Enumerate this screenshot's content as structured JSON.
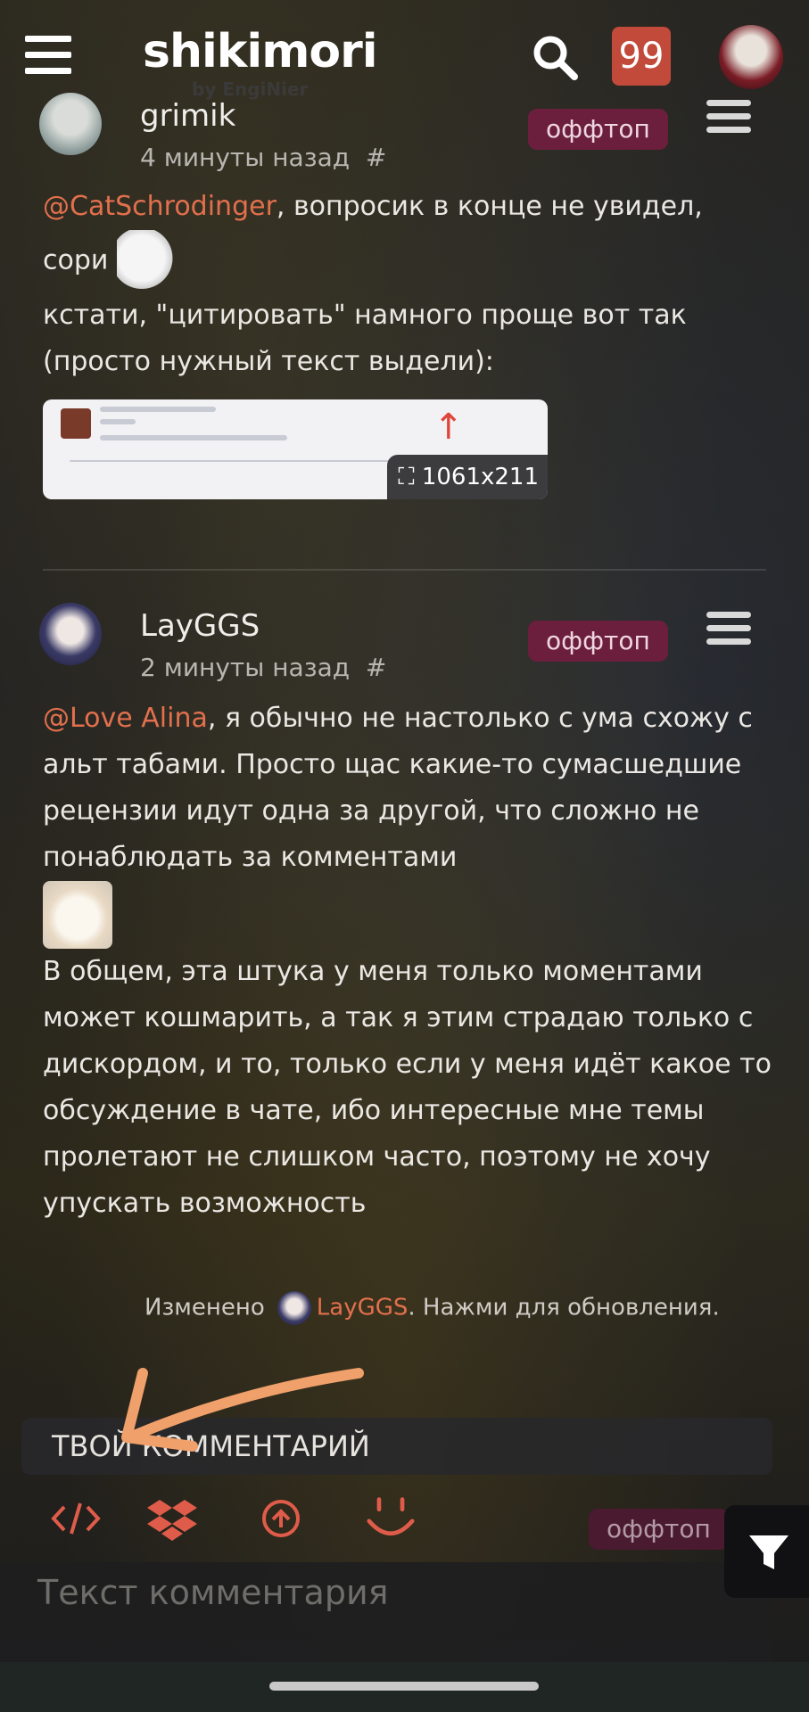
{
  "header": {
    "logo": "shikimori",
    "logo_sub": "by EngiNier",
    "notification_count": "99"
  },
  "comments": [
    {
      "author": "grimik",
      "time": "4 минуты назад",
      "hash": "#",
      "tag": "оффтоп",
      "mention": "@CatSchrodinger",
      "text_line1": ", вопросик в конце не увидел,",
      "text_line2": "сори",
      "text_line3": "кстати, \"цитировать\" намного проще вот так (просто нужный текст выдели):",
      "image_dimensions": "1061x211"
    },
    {
      "author": "LayGGS",
      "time": "2 минуты назад",
      "hash": "#",
      "tag": "оффтоп",
      "mention": "@Love Alina",
      "text_part1": ", я обычно не настолько с ума схожу с альт табами. Просто щас какие-то сумасшедшие рецензии идут одна за другой, что сложно не понаблюдать за комментами",
      "text_part2": "В общем, эта штука у меня только моментами может кошмарить, а так я этим страдаю только с дискордом, и то, только если у меня идёт какое то обсуждение в чате, ибо интересные мне темы пролетают не слишком часто, поэтому не хочу упускать возможность",
      "edited_label": "Изменено",
      "edited_by": "LayGGS",
      "edited_suffix": ". Нажми для обновления."
    }
  ],
  "reply": {
    "header": "ТВОЙ КОММЕНТАРИЙ",
    "tag": "оффтоп",
    "placeholder": "Текст комментария"
  },
  "icons": [
    "menu-icon",
    "search-icon",
    "code-icon",
    "dropbox-icon",
    "upload-icon",
    "smiley-icon",
    "filter-icon",
    "expand-icon"
  ],
  "colors": {
    "accent": "#e2704d",
    "badge": "#c24a3a",
    "tag": "#6b1f3c",
    "arrow": "#f0a06a"
  }
}
